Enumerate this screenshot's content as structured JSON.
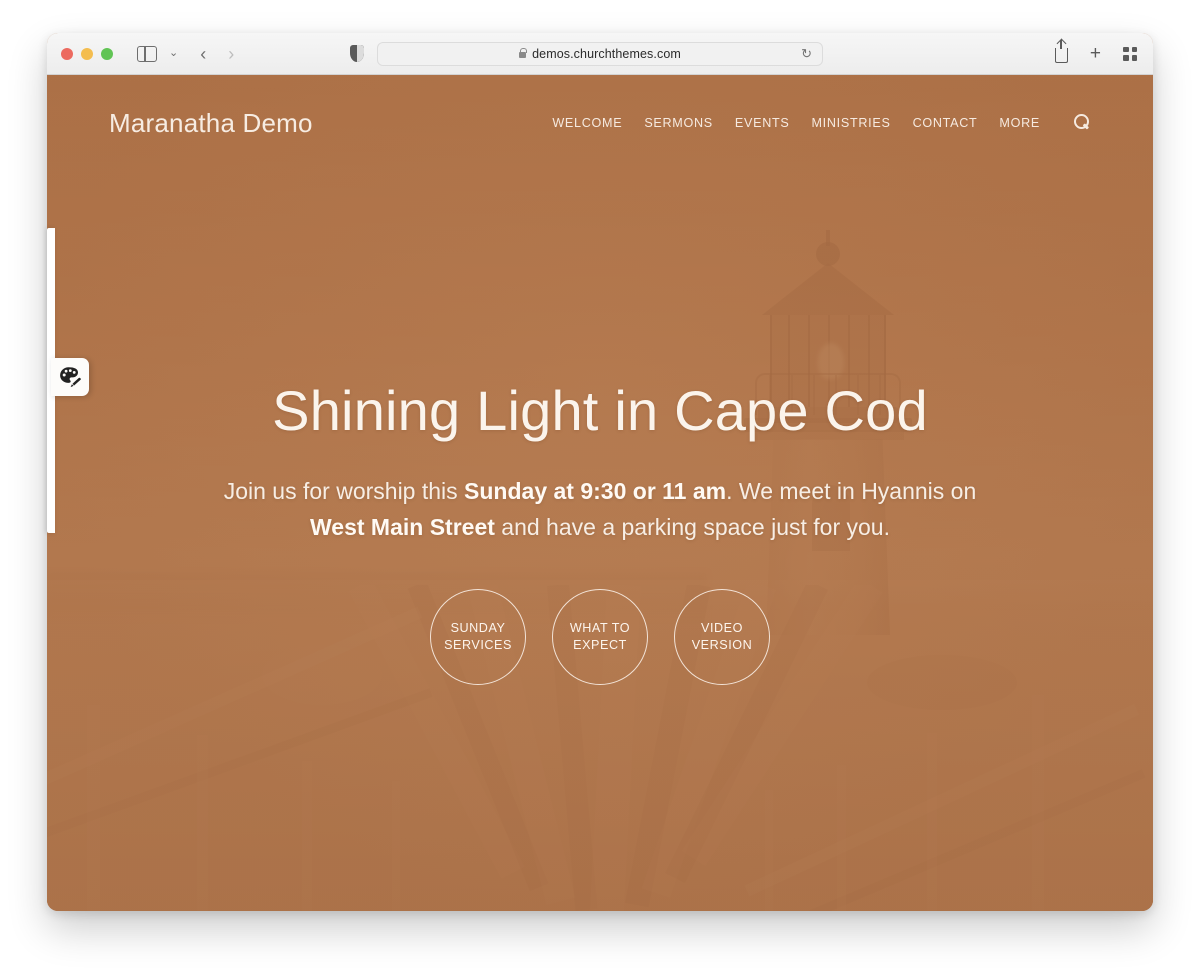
{
  "browser": {
    "traffic_lights": [
      "close",
      "minimize",
      "maximize"
    ],
    "sidebar_toggle_label": "Show Sidebar",
    "tab_overview_chevron": "⌄",
    "back_arrow": "‹",
    "forward_arrow": "›",
    "shield_icon_name": "privacy-shield-icon",
    "url": "demos.churchthemes.com",
    "reload_glyph": "↻",
    "right_icons": [
      {
        "name": "share-icon",
        "label": "Share"
      },
      {
        "name": "new-tab-icon",
        "label": "+"
      },
      {
        "name": "tab-overview-icon",
        "label": "Show Tab Overview"
      }
    ]
  },
  "site": {
    "brand": "Maranatha Demo",
    "nav": [
      {
        "label": "WELCOME"
      },
      {
        "label": "SERMONS"
      },
      {
        "label": "EVENTS"
      },
      {
        "label": "MINISTRIES"
      },
      {
        "label": "CONTACT"
      },
      {
        "label": "MORE"
      }
    ],
    "search_icon_name": "search-icon",
    "hero": {
      "title": "Shining Light in Cape Cod",
      "sub_part1": "Join us for worship this ",
      "sub_bold1": "Sunday at 9:30 or 11 am",
      "sub_part2": ". We meet in Hyannis on ",
      "sub_bold2": "West Main Street",
      "sub_part3": " and have a parking space just for you.",
      "buttons": [
        {
          "line1": "SUNDAY",
          "line2": "SERVICES"
        },
        {
          "line1": "WHAT TO",
          "line2": "EXPECT"
        },
        {
          "line1": "VIDEO",
          "line2": "VERSION"
        }
      ],
      "scroll_hint_icon": "chevron-down-icon"
    },
    "customizer_tab_icon": "paint-palette-icon"
  },
  "colors": {
    "overlay": "#b5794e",
    "text_cream": "#f7ece2",
    "chrome_bg": "#f0f0f0"
  }
}
